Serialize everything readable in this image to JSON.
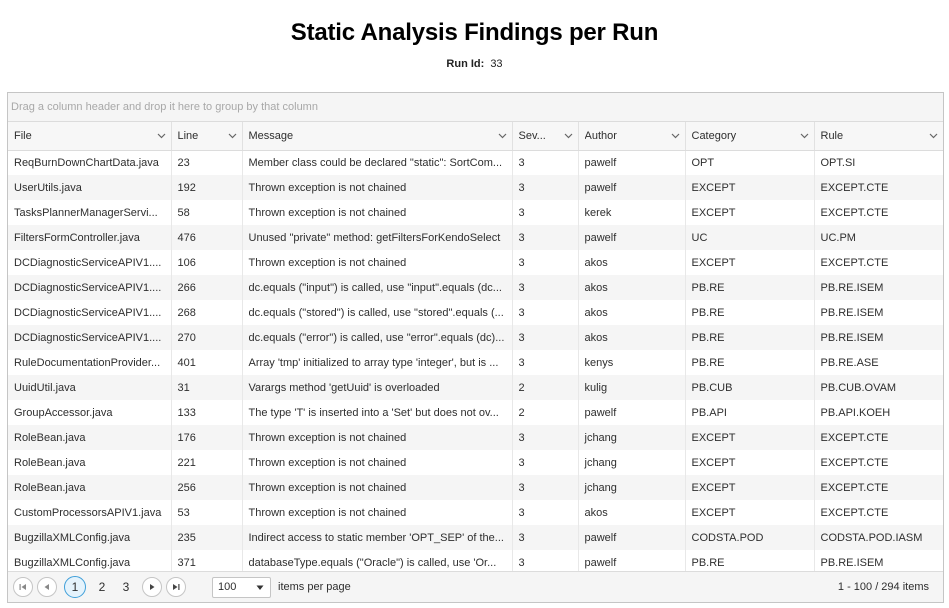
{
  "page": {
    "title": "Static Analysis Findings per Run",
    "run_id_label": "Run Id:",
    "run_id_value": "33"
  },
  "grid": {
    "group_placeholder": "Drag a column header and drop it here to group by that column",
    "columns": [
      "File",
      "Line",
      "Message",
      "Sev...",
      "Author",
      "Category",
      "Rule"
    ],
    "rows": [
      [
        "ReqBurnDownChartData.java",
        "23",
        "Member class could be declared \"static\": SortCom...",
        "3",
        "pawelf",
        "OPT",
        "OPT.SI"
      ],
      [
        "UserUtils.java",
        "192",
        "Thrown exception is not chained",
        "3",
        "pawelf",
        "EXCEPT",
        "EXCEPT.CTE"
      ],
      [
        "TasksPlannerManagerServi...",
        "58",
        "Thrown exception is not chained",
        "3",
        "kerek",
        "EXCEPT",
        "EXCEPT.CTE"
      ],
      [
        "FiltersFormController.java",
        "476",
        "Unused \"private\" method: getFiltersForKendoSelect",
        "3",
        "pawelf",
        "UC",
        "UC.PM"
      ],
      [
        "DCDiagnosticServiceAPIV1....",
        "106",
        "Thrown exception is not chained",
        "3",
        "akos",
        "EXCEPT",
        "EXCEPT.CTE"
      ],
      [
        "DCDiagnosticServiceAPIV1....",
        "266",
        "dc.equals (\"input\") is called, use \"input\".equals (dc...",
        "3",
        "akos",
        "PB.RE",
        "PB.RE.ISEM"
      ],
      [
        "DCDiagnosticServiceAPIV1....",
        "268",
        "dc.equals (\"stored\") is called, use \"stored\".equals (...",
        "3",
        "akos",
        "PB.RE",
        "PB.RE.ISEM"
      ],
      [
        "DCDiagnosticServiceAPIV1....",
        "270",
        "dc.equals (\"error\") is called, use \"error\".equals (dc)...",
        "3",
        "akos",
        "PB.RE",
        "PB.RE.ISEM"
      ],
      [
        "RuleDocumentationProvider...",
        "401",
        "Array 'tmp' initialized to array type 'integer', but is ...",
        "3",
        "kenys",
        "PB.RE",
        "PB.RE.ASE"
      ],
      [
        "UuidUtil.java",
        "31",
        "Varargs method 'getUuid' is overloaded",
        "2",
        "kulig",
        "PB.CUB",
        "PB.CUB.OVAM"
      ],
      [
        "GroupAccessor.java",
        "133",
        "The type 'T' is inserted into a 'Set' but does not ov...",
        "2",
        "pawelf",
        "PB.API",
        "PB.API.KOEH"
      ],
      [
        "RoleBean.java",
        "176",
        "Thrown exception is not chained",
        "3",
        "jchang",
        "EXCEPT",
        "EXCEPT.CTE"
      ],
      [
        "RoleBean.java",
        "221",
        "Thrown exception is not chained",
        "3",
        "jchang",
        "EXCEPT",
        "EXCEPT.CTE"
      ],
      [
        "RoleBean.java",
        "256",
        "Thrown exception is not chained",
        "3",
        "jchang",
        "EXCEPT",
        "EXCEPT.CTE"
      ],
      [
        "CustomProcessorsAPIV1.java",
        "53",
        "Thrown exception is not chained",
        "3",
        "akos",
        "EXCEPT",
        "EXCEPT.CTE"
      ],
      [
        "BugzillaXMLConfig.java",
        "235",
        "Indirect access to static member 'OPT_SEP' of the...",
        "3",
        "pawelf",
        "CODSTA.POD",
        "CODSTA.POD.IASM"
      ],
      [
        "BugzillaXMLConfig.java",
        "371",
        "databaseType.equals (\"Oracle\") is called, use 'Or...",
        "3",
        "pawelf",
        "PB.RE",
        "PB.RE.ISEM"
      ]
    ]
  },
  "pager": {
    "pages": [
      "1",
      "2",
      "3"
    ],
    "current_page": "1",
    "page_size": "100",
    "items_per_page_label": "items per page",
    "info": "1 - 100 / 294 items",
    "icons": [
      "first-page-icon",
      "prev-page-icon",
      "next-page-icon",
      "last-page-icon"
    ]
  },
  "colors": {
    "accent": "#3f9fd9",
    "header_bg": "#f7f7f7",
    "alt_row": "#f5f5f5",
    "border": "#c5c5c5"
  }
}
